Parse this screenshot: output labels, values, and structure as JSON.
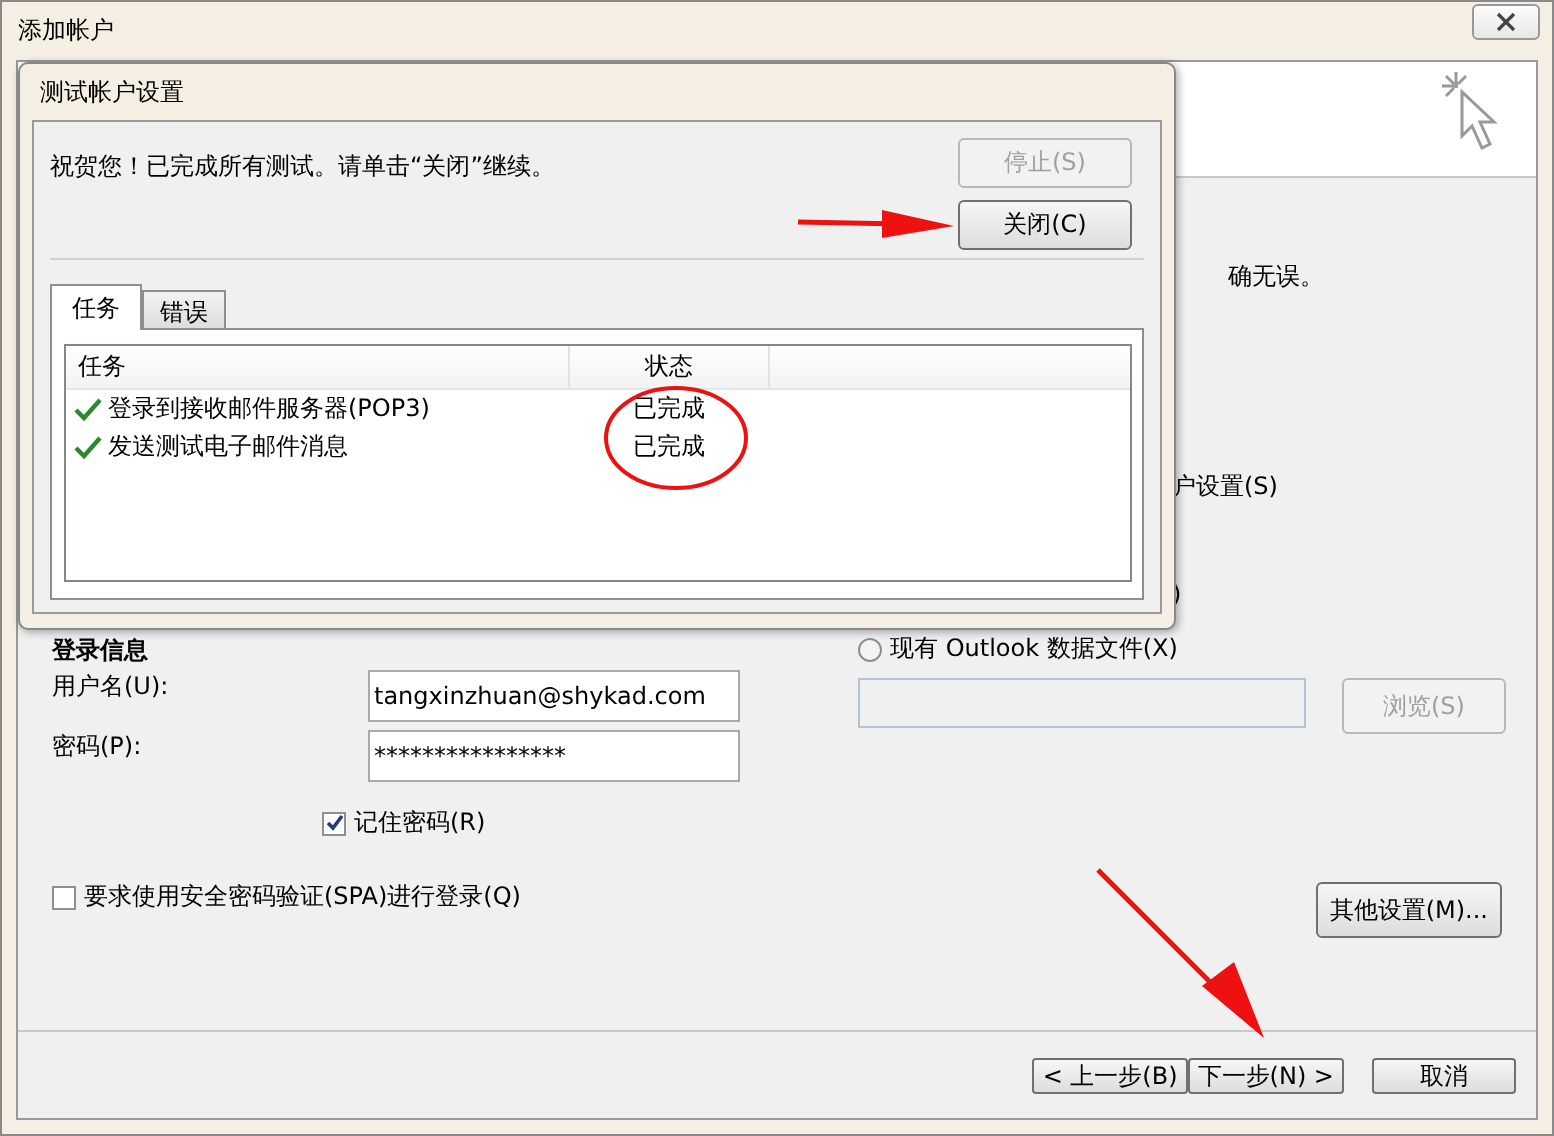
{
  "window": {
    "title": "添加帐户"
  },
  "background_dialog": {
    "fragments": [
      "确无误。",
      "户设置(S)",
      ")"
    ],
    "login_info": {
      "heading": "登录信息",
      "username": {
        "label": "用户名(U):",
        "value": "tangxinzhuan@shykad.com"
      },
      "password": {
        "label": "密码(P):",
        "value": "****************"
      },
      "remember_password": {
        "label": "记住密码(R)",
        "checked": true
      },
      "spa": {
        "label": "要求使用安全密码验证(SPA)进行登录(Q)",
        "checked": false
      }
    },
    "existing_file": {
      "label": "现有 Outlook 数据文件(X)",
      "selected": false,
      "browse_button": {
        "label": "浏览(S)",
        "disabled": true
      }
    },
    "more_settings_button": "其他设置(M)...",
    "footer_buttons": [
      "< 上一步(B)",
      "下一步(N) >",
      "取消"
    ]
  },
  "test_dialog": {
    "title": "测试帐户设置",
    "message": "祝贺您！已完成所有测试。请单击“关闭”继续。",
    "stop_button": {
      "label": "停止(S)",
      "disabled": true
    },
    "close_button": {
      "label": "关闭(C)",
      "disabled": false
    },
    "tabs": [
      {
        "label": "任务",
        "selected": true
      },
      {
        "label": "错误",
        "selected": false
      }
    ],
    "columns": [
      "任务",
      "状态"
    ],
    "rows": [
      {
        "task": "登录到接收邮件服务器(POP3)",
        "status": "已完成",
        "done": true
      },
      {
        "task": "发送测试电子邮件消息",
        "status": "已完成",
        "done": true
      }
    ]
  }
}
